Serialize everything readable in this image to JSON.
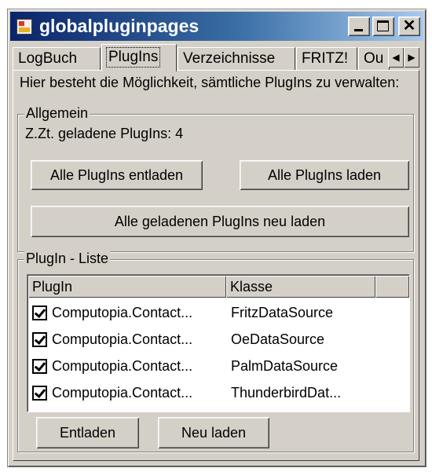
{
  "window": {
    "title": "globalpluginpages"
  },
  "tabs": [
    {
      "label": "LogBuch"
    },
    {
      "label": "PlugIns"
    },
    {
      "label": "Verzeichnisse"
    },
    {
      "label": "FRITZ!"
    },
    {
      "label": "Ou"
    }
  ],
  "page": {
    "description": "Hier besteht die Möglichkeit, sämtliche PlugIns zu verwalten:",
    "general": {
      "legend": "Allgemein",
      "loaded_label": "Z.Zt. geladene PlugIns: 4",
      "unload_all": "Alle PlugIns entladen",
      "load_all": "Alle PlugIns laden",
      "reload_all": "Alle geladenen PlugIns neu laden"
    },
    "plugin_list": {
      "legend": "PlugIn - Liste",
      "columns": [
        "PlugIn",
        "Klasse",
        ""
      ],
      "rows": [
        {
          "plugin": "Computopia.Contact...",
          "class": "FritzDataSource",
          "checked": true
        },
        {
          "plugin": "Computopia.Contact...",
          "class": "OeDataSource",
          "checked": true
        },
        {
          "plugin": "Computopia.Contact...",
          "class": "PalmDataSource",
          "checked": true
        },
        {
          "plugin": "Computopia.Contact...",
          "class": "ThunderbirdDat...",
          "checked": true
        }
      ],
      "unload": "Entladen",
      "reload": "Neu laden"
    }
  }
}
